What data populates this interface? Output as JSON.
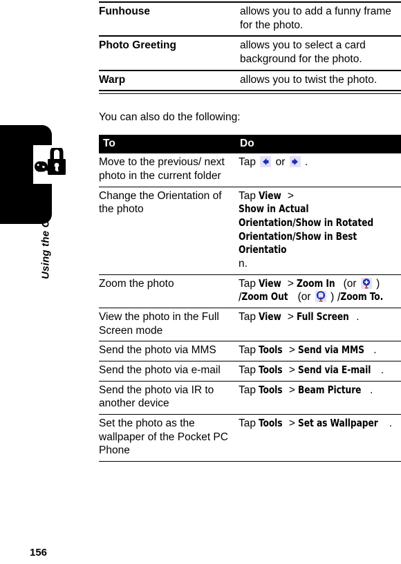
{
  "page": {
    "number": "156",
    "sidebar_label": "Using the Camera",
    "sidebar_icon": "lock-and-key-icon"
  },
  "feature_table": {
    "rows": [
      {
        "term": "Funhouse",
        "description": "allows you to add a funny frame for the photo."
      },
      {
        "term": "Photo Greeting",
        "description": "allows you to select a card background for the photo."
      },
      {
        "term": "Warp",
        "description": "allows you to twist the photo."
      }
    ]
  },
  "intro_text": "You can also do the following:",
  "task_table": {
    "headers": {
      "to": "To",
      "do": "Do"
    },
    "rows": [
      {
        "to": "Move to the previous/ next photo in the current folder",
        "do_parts": [
          {
            "type": "text",
            "value": "Tap "
          },
          {
            "type": "icon",
            "value": "left-arrow-icon"
          },
          {
            "type": "text",
            "value": "  or "
          },
          {
            "type": "icon",
            "value": "right-arrow-icon"
          },
          {
            "type": "text",
            "value": "  ."
          }
        ]
      },
      {
        "to": "Change the Orientation of the photo",
        "do_parts": [
          {
            "type": "text",
            "value": "Tap "
          },
          {
            "type": "ui",
            "value": "View"
          },
          {
            "type": "sep",
            "value": " > "
          },
          {
            "type": "ui",
            "value": "Show in Actual Orientation/Show in Rotated Orientation/Show in Best Orientatio"
          },
          {
            "type": "text",
            "value": "n."
          }
        ]
      },
      {
        "to": "Zoom the photo",
        "do_parts": [
          {
            "type": "text",
            "value": "Tap "
          },
          {
            "type": "ui",
            "value": "View"
          },
          {
            "type": "sep",
            "value": " > "
          },
          {
            "type": "ui",
            "value": "Zoom In"
          },
          {
            "type": "text",
            "value": " (or "
          },
          {
            "type": "icon",
            "value": "zoom-in-icon"
          },
          {
            "type": "text",
            "value": " ) "
          },
          {
            "type": "ui",
            "value": "/Zoom Out"
          },
          {
            "type": "text",
            "value": " (or "
          },
          {
            "type": "icon",
            "value": "zoom-out-icon"
          },
          {
            "type": "text",
            "value": " ) "
          },
          {
            "type": "ui",
            "value": "/Zoom To."
          }
        ]
      },
      {
        "to": "View the photo in the Full Screen mode",
        "do_parts": [
          {
            "type": "text",
            "value": "Tap "
          },
          {
            "type": "ui",
            "value": "View"
          },
          {
            "type": "sep",
            "value": " > "
          },
          {
            "type": "ui",
            "value": "Full Screen"
          },
          {
            "type": "text",
            "value": "."
          }
        ]
      },
      {
        "to": "Send the photo via MMS",
        "do_parts": [
          {
            "type": "text",
            "value": "Tap "
          },
          {
            "type": "ui",
            "value": "Tools"
          },
          {
            "type": "sep",
            "value": " > "
          },
          {
            "type": "ui",
            "value": "Send via MMS"
          },
          {
            "type": "text",
            "value": "."
          }
        ]
      },
      {
        "to": "Send the photo via e-mail",
        "do_parts": [
          {
            "type": "text",
            "value": "Tap "
          },
          {
            "type": "ui",
            "value": "Tools"
          },
          {
            "type": "sep",
            "value": " > "
          },
          {
            "type": "ui",
            "value": "Send via E-mail"
          },
          {
            "type": "text",
            "value": "."
          }
        ]
      },
      {
        "to": "Send the photo via IR to another device",
        "do_parts": [
          {
            "type": "text",
            "value": "Tap "
          },
          {
            "type": "ui",
            "value": "Tools"
          },
          {
            "type": "sep",
            "value": " > "
          },
          {
            "type": "ui",
            "value": "Beam Picture"
          },
          {
            "type": "text",
            "value": "."
          }
        ]
      },
      {
        "to": "Set the photo as the wallpaper of the Pocket PC Phone",
        "do_parts": [
          {
            "type": "text",
            "value": "Tap "
          },
          {
            "type": "ui",
            "value": "Tools"
          },
          {
            "type": "sep",
            "value": " > "
          },
          {
            "type": "ui",
            "value": "Set as Wallpaper"
          },
          {
            "type": "text",
            "value": "."
          }
        ]
      }
    ]
  },
  "colors": {
    "icon_chip_background": "#e6e0f5",
    "icon_blue": "#1a2fb0",
    "icon_stem": "#b2441f",
    "rule": "#000000",
    "header_background": "#000000",
    "header_text": "#ffffff"
  }
}
